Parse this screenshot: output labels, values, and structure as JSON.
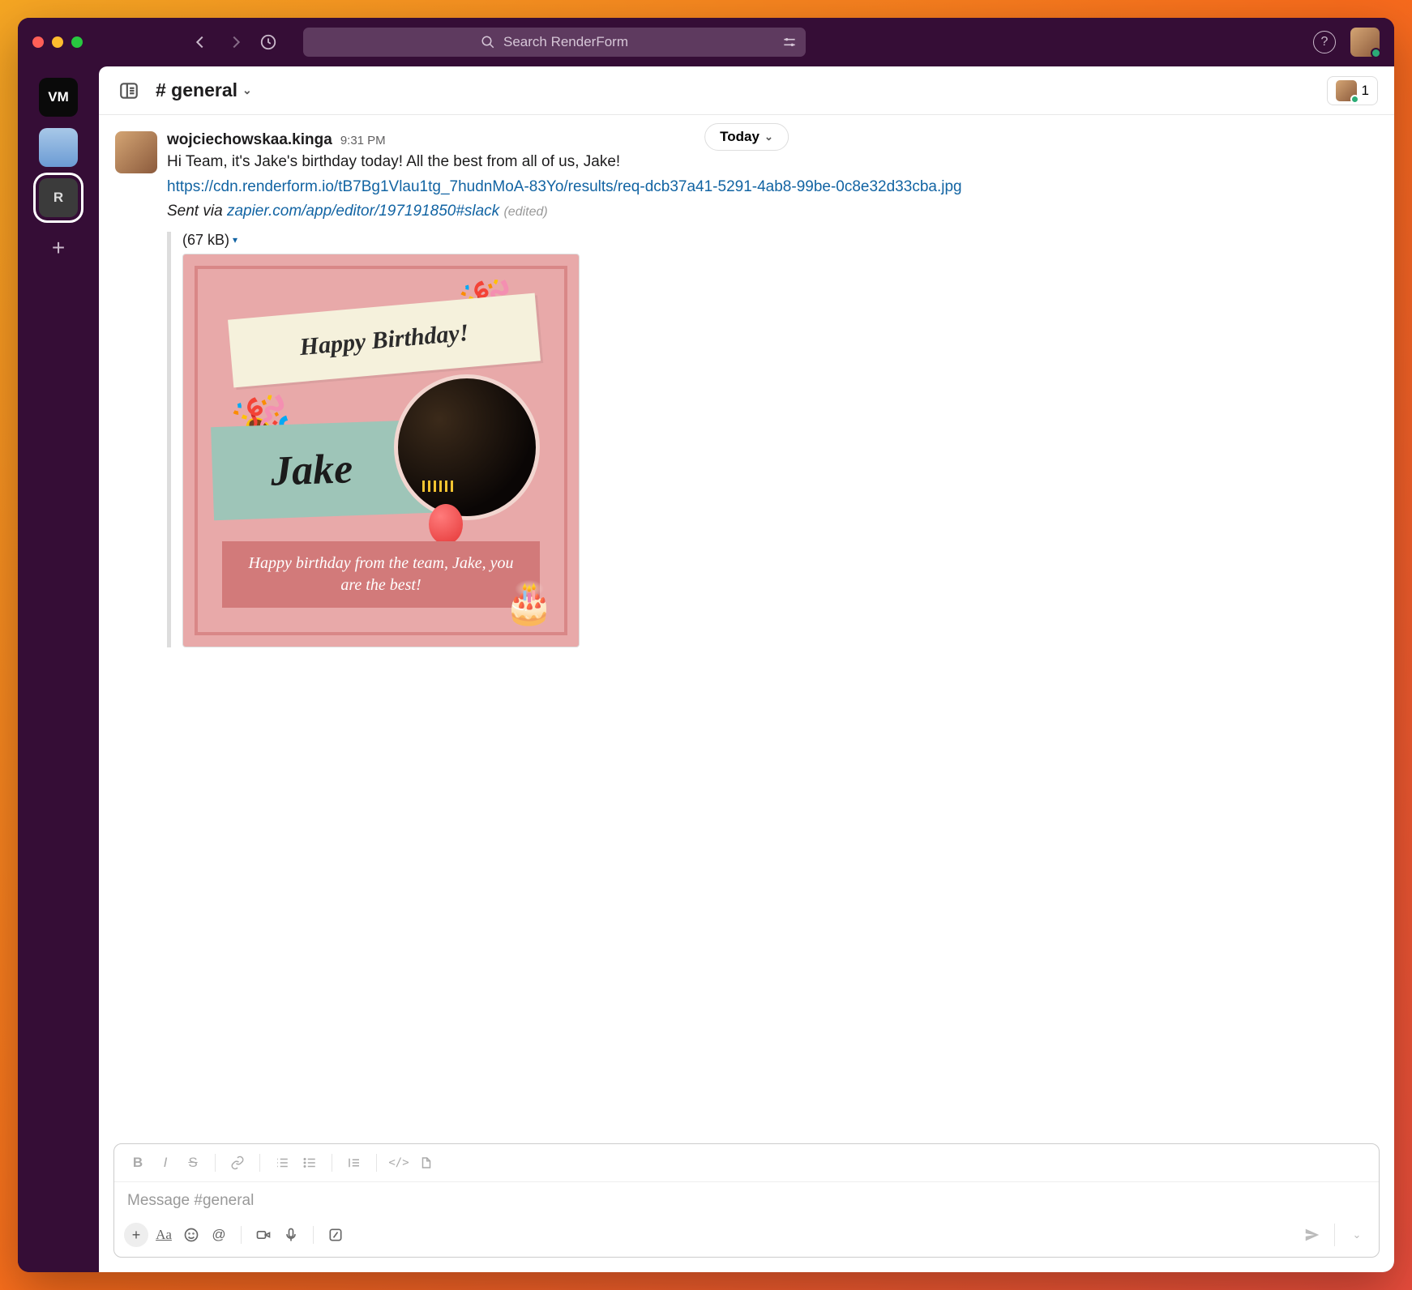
{
  "search": {
    "placeholder": "Search RenderForm"
  },
  "rail": {
    "workspaces": [
      "VM",
      "",
      "R"
    ]
  },
  "channel": {
    "name": "# general",
    "member_count": "1"
  },
  "date_pill": "Today",
  "message": {
    "author": "wojciechowskaa.kinga",
    "time": "9:31 PM",
    "text": "Hi Team, it's Jake's birthday today! All the best from all of us, Jake!",
    "link": "https://cdn.renderform.io/tB7Bg1Vlau1tg_7hudnMoA-83Yo/results/req-dcb37a41-5291-4ab8-99be-0c8e32d33cba.jpg",
    "sent_via_prefix": "Sent via ",
    "sent_via_link": "zapier.com/app/editor/197191850#slack",
    "edited": "(edited)"
  },
  "attachment": {
    "size": "(67 kB)",
    "card": {
      "title": "Happy Birthday!",
      "name": "Jake",
      "footer": "Happy birthday from the team, Jake, you are the best!"
    }
  },
  "composer": {
    "placeholder": "Message #general"
  }
}
